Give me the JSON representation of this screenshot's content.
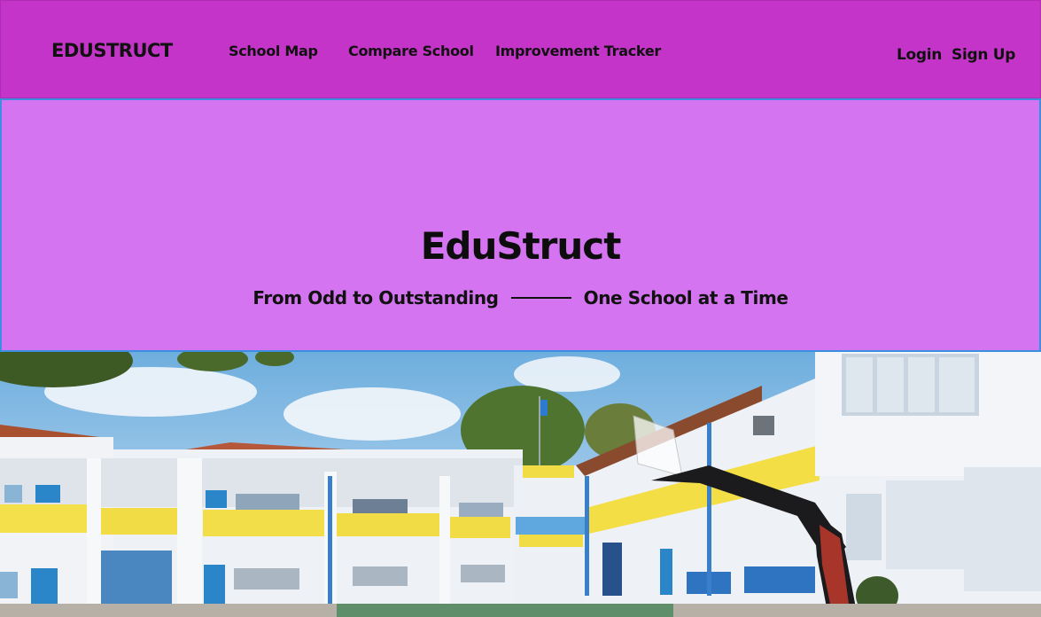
{
  "navbar": {
    "brand": "EDUSTRUCT",
    "links": [
      {
        "label": "School Map"
      },
      {
        "label": "Compare School"
      },
      {
        "label": "Improvement Tracker"
      }
    ],
    "login_label": "Login",
    "signup_label": "Sign Up"
  },
  "hero": {
    "title": "EduStruct",
    "tagline_left": "From Odd to Outstanding",
    "tagline_right": "One School at a Time"
  },
  "colors": {
    "navbar_bg": "#c534c8",
    "hero_bg": "#d474f0",
    "hero_border": "#3b8fe0",
    "text": "#111111"
  }
}
